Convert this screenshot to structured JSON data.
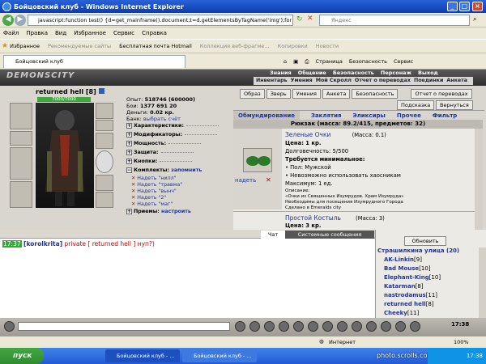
{
  "window": {
    "title": "Бойцовский клуб - Windows Internet Explorer",
    "min": "_",
    "max": "□",
    "close": "×"
  },
  "address": {
    "url": "javascript:function test() {d=get_mainframe().document;t=d.getElementsByTagName('img');for (i=0;i<t.le",
    "search_placeholder": "Яндекс"
  },
  "menu": [
    "Файл",
    "Правка",
    "Вид",
    "Избранное",
    "Сервис",
    "Справка"
  ],
  "favorites": {
    "label": "Избранное",
    "items": [
      "Рекомендуемые сайты",
      "Бесплатная почта Hotmail",
      "Коллекция веб-фрагме...",
      "Копировки",
      "Новости"
    ]
  },
  "tab": {
    "title": "Бойцовский клуб"
  },
  "commands": [
    "Страница",
    "Безопасность",
    "Сервис"
  ],
  "game": {
    "logo": "DEMONSCITY",
    "topnav": [
      "Знания",
      "Общение",
      "Безопасность",
      "Персонаж",
      "Выход"
    ],
    "subnav": [
      "Инвентарь",
      "Умения",
      "Мой Скролл",
      "Отчет о переводах",
      "Поединки",
      "Анкета"
    ],
    "character": {
      "name": "returned hell",
      "level": "[8]",
      "hp": "7000/7000",
      "stats": [
        {
          "label": "Опыт:",
          "value": "518746 (600000)"
        },
        {
          "label": "Бои:",
          "value": "1377  691  20"
        },
        {
          "label": "Деньги:",
          "value": "0.02 кр."
        },
        {
          "label": "Банк:",
          "value": "выбрать счёт"
        }
      ],
      "sections": [
        "Характеристики:",
        "Модификаторы:",
        "Мощность:",
        "Защита:",
        "Кнопки:",
        "Комплекты:"
      ],
      "sets_link": "запомнить",
      "wear_items": [
        "Надеть \"нилл\"",
        "Надеть \"травма\"",
        "Надеть \"вынч\"",
        "Надеть \"2\"",
        "Надеть \"маг\""
      ],
      "techniques": {
        "label": "Приемы:",
        "link": "настроить"
      }
    },
    "actions": [
      "Образ",
      "Зверь",
      "Умения",
      "Анкета",
      "Безопасность",
      "Отчет о переводах"
    ],
    "actions2": [
      "Подсказка",
      "Вернуться"
    ],
    "shop_tabs": [
      "Обмундирование",
      "Заклятия",
      "Эликсиры",
      "Прочее",
      "Фильтр"
    ],
    "backpack": "Рюкзак (масса: 89.2/415, предметов: 32)",
    "item1": {
      "name": "Зеленые Очки",
      "weight": "(Масса: 0.1)",
      "price": "Цена: 1 кр.",
      "durability": "Долговечность: 5/500",
      "req_title": "Требуется минимальное:",
      "req1": "• Пол: Мужской",
      "req2": "• Невозможно использовать хаосникам",
      "max": "Максимум: 1 ед.",
      "desc_title": "Описание:",
      "desc1": "«Очки из Священных Изумрудов. Храм Изумруда»",
      "desc2": "Необходимы для посещения Изумрудного Города",
      "desc3": "Сделано в Emeralds city",
      "wear_label": "надеть"
    },
    "item2": {
      "name": "Простой Костыль",
      "weight": "(Масса: 3)",
      "price": "Цена: 3 кр."
    },
    "chat_tabs": [
      "Чат",
      "Системные сообщения"
    ],
    "chat": {
      "time": "17:37",
      "from": "[korolkrita]",
      "private": "private [ returned hell ]",
      "msg": "нуп?)"
    },
    "refresh": "Обновить",
    "street": "Страшилкина улица (20)",
    "players": [
      {
        "name": "AK-Linkin",
        "lvl": "[9]"
      },
      {
        "name": "Bad Mouse",
        "lvl": "[10]"
      },
      {
        "name": "Elephant-King",
        "lvl": "[10]"
      },
      {
        "name": "Katarman",
        "lvl": "[8]"
      },
      {
        "name": "nastrodamus",
        "lvl": "[11]"
      },
      {
        "name": "returned hell",
        "lvl": "[8]"
      },
      {
        "name": "Cheeky",
        "lvl": "[11]"
      }
    ],
    "clock": "17:38"
  },
  "status": {
    "zone": "Интернет",
    "zoom": "100%"
  },
  "taskbar": {
    "start": "пуск",
    "tasks": [
      "Бойцовский клуб - ...",
      "Бойцовский клуб - ..."
    ],
    "watermark": "photo.scrolls.combats.com",
    "time": "17:38"
  }
}
